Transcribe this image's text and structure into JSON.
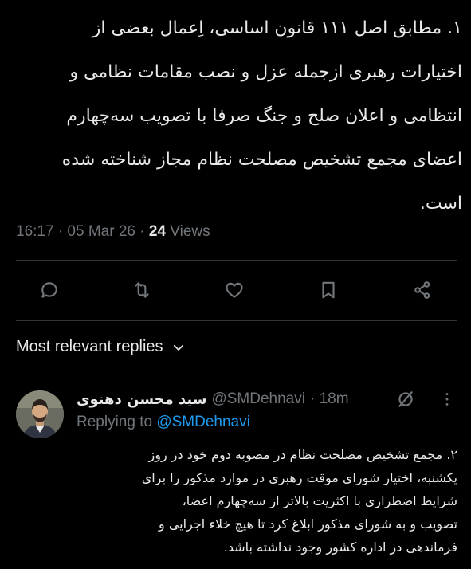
{
  "tweet": {
    "text": "۱. مطابق اصل ۱۱۱ قانون اساسی، اِعمال بعضی از\nاختیارات رهبری ازجمله عزل و نصب مقامات نظامی و\nانتظامی و اعلان صلح و جنگ صرفا با تصویب سه‌چهارم\nاعضای مجمع تشخیص مصلحت نظام مجاز شناخته شده\nاست.",
    "time": "16:17 · 05 Mar 26 · ",
    "views_count": "24",
    "views_label": " Views"
  },
  "actions": {
    "reply_icon": "reply-icon",
    "repost_icon": "repost-icon",
    "like_icon": "like-icon",
    "bookmark_icon": "bookmark-icon",
    "share_icon": "share-icon"
  },
  "replies": {
    "header": "Most relevant replies"
  },
  "reply": {
    "name": "سید محسن دهنوی",
    "handle": "@SMDehnavi",
    "time": "· 18m",
    "replying_prefix": "Replying to ",
    "replying_handle": "@SMDehnavi",
    "text": "۲. مجمع تشخیص مصلحت نظام در مصوبه دوم خود در روز\nیکشنبه، اختیار شورای موقت رهبری در موارد مذکور را برای\nشرایط اضطراری با اکثریت بالاتر از سه‌چهارم اعضا،\nتصویب و به شورای مذکور ابلاغ کرد تا هیچ خلاء اجرایی و\nفرماندهی در اداره کشور وجود نداشته باشد."
  },
  "colors": {
    "background": "#000000",
    "text": "#e7e9ea",
    "muted": "#71767b",
    "link": "#1d9bf0",
    "divider": "#2f3336"
  }
}
